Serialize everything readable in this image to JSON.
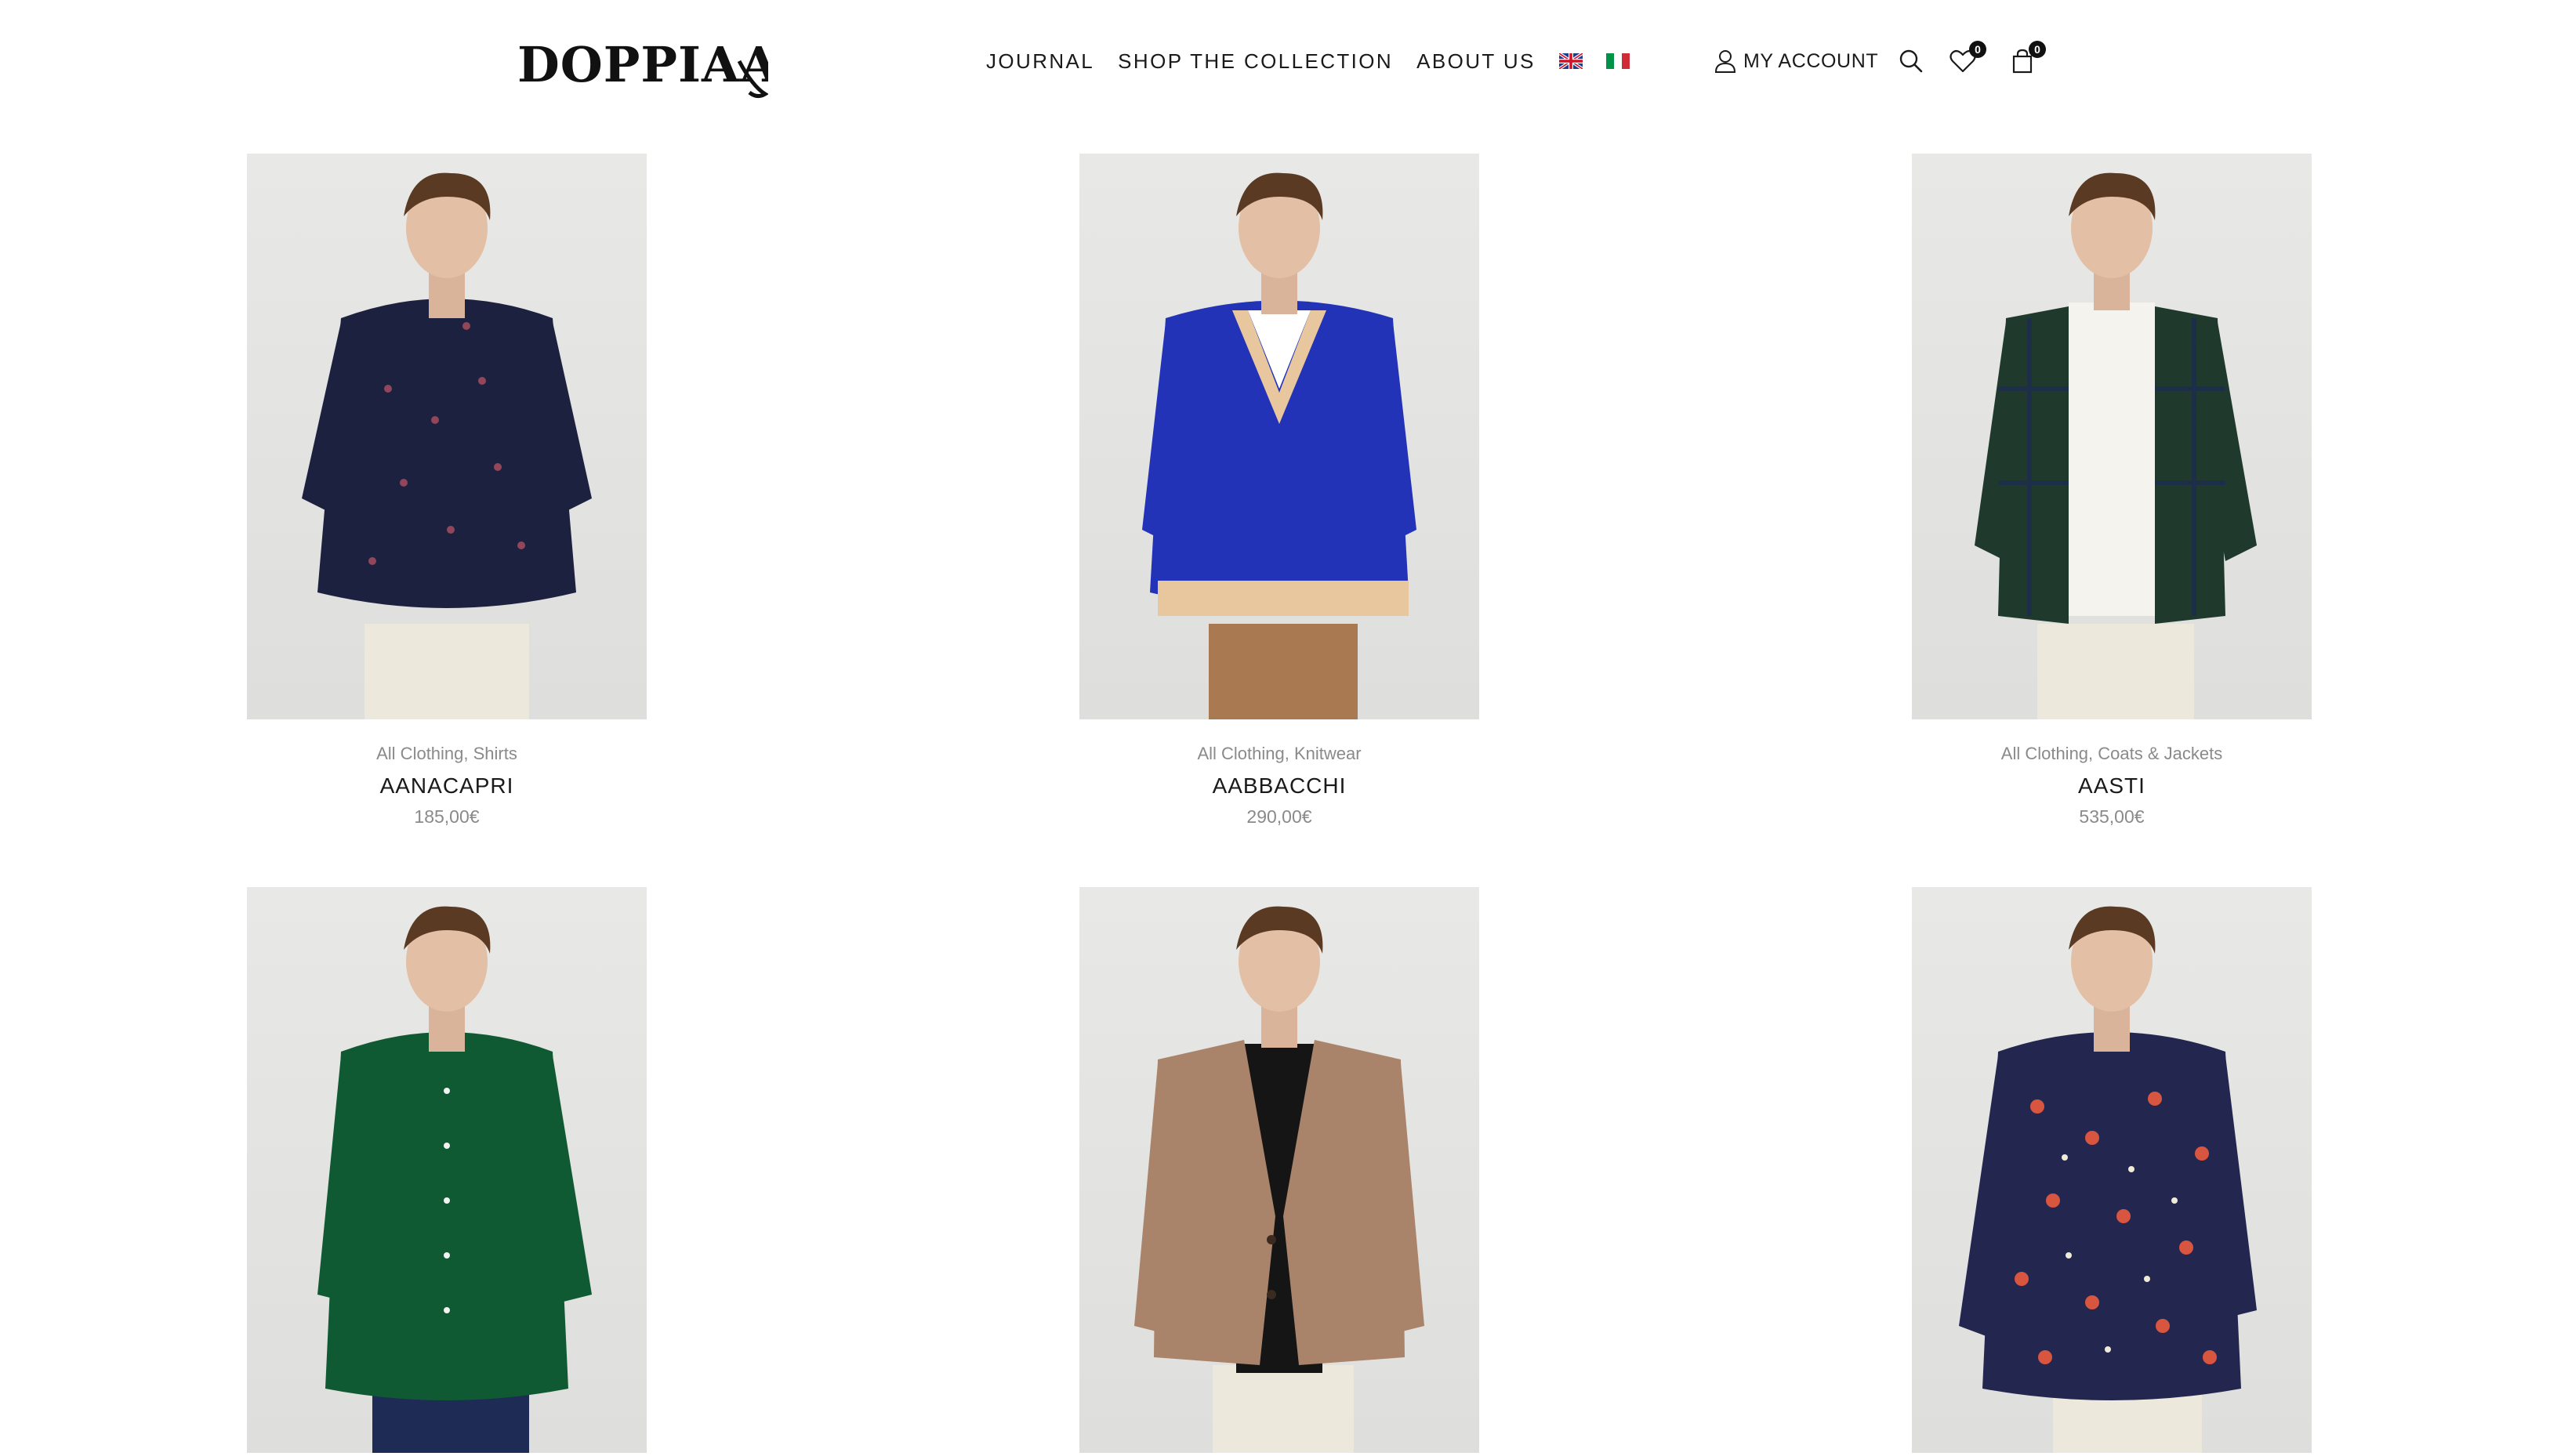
{
  "brand": {
    "logo_text": "DOPPIAA"
  },
  "nav": {
    "items": [
      {
        "label": "JOURNAL"
      },
      {
        "label": "SHOP THE COLLECTION"
      },
      {
        "label": "ABOUT US"
      }
    ],
    "languages": [
      {
        "flag": "uk-flag-icon"
      },
      {
        "flag": "italy-flag-icon"
      }
    ]
  },
  "header_actions": {
    "account_label": "MY ACCOUNT",
    "wishlist_count": "0",
    "cart_count": "0"
  },
  "products": [
    {
      "categories": "All Clothing, Shirts",
      "name": "AANACAPRI",
      "price": "185,00€",
      "garment": "navy printed shirt",
      "color": "#1d2140"
    },
    {
      "categories": "All Clothing, Knitwear",
      "name": "AABBACCHI",
      "price": "290,00€",
      "garment": "cobalt v-neck sweater",
      "color": "#2233b8"
    },
    {
      "categories": "All Clothing, Coats & Jackets",
      "name": "AASTI",
      "price": "535,00€",
      "garment": "green plaid overshirt",
      "color": "#1f3a2c"
    },
    {
      "garment": "green linen shirt",
      "color": "#0f5a32"
    },
    {
      "garment": "camel blazer with black polo",
      "color": "#a9836a"
    },
    {
      "garment": "navy patterned shirt",
      "color": "#23264f"
    }
  ],
  "colors": {
    "text": "#1a1a1a",
    "muted": "#8a8a8a",
    "image_bg": "#e4e4e2"
  }
}
